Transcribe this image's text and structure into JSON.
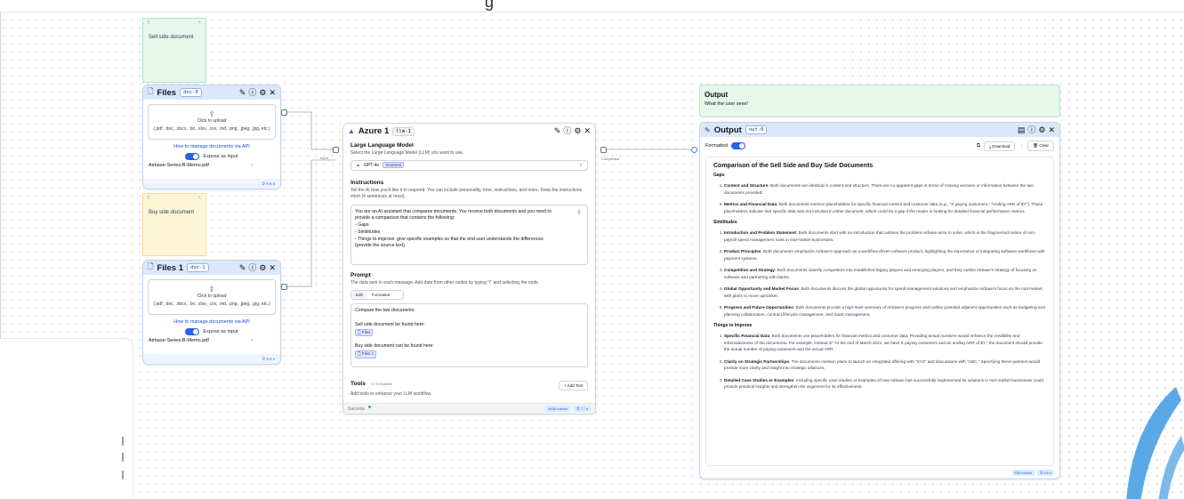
{
  "notes": {
    "sell": "Sell side document",
    "buy": "Buy side document",
    "output_title": "Output",
    "output_sub": "What the user sees!"
  },
  "files0": {
    "title": "Files",
    "tag": "doc-0",
    "upload_label": "Click to upload",
    "upload_types": "(.pdf, .doc, .docx, .txt, .xlsx, .csv, .md, .png, .jpeg, .jpg, etc.)",
    "api_link": "How to manage documents via API",
    "expose_label": "Expose as input",
    "file_name": "Airbase-Series-B-Memo.pdf",
    "footer": "⏱ 9.6 s"
  },
  "files1": {
    "title": "Files 1",
    "tag": "doc-1",
    "upload_label": "Click to upload",
    "upload_types": "(.pdf, .doc, .docx, .txt, .xlsx, .csv, .md, .png, .jpeg, .jpg, etc.)",
    "api_link": "How to manage documents via API",
    "expose_label": "Expose as input",
    "file_name": "Airbase-Series-B-Memo.pdf",
    "footer": "⏱ 3.2 s"
  },
  "llm": {
    "title": "Azure 1",
    "tag": "llm-1",
    "section_title": "Large Language Model",
    "section_sub": "Select the Large Language Model (LLM) you want to use.",
    "model": "GPT-4o",
    "model_badge": "Smartest",
    "instr_title": "Instructions",
    "instr_sub": "Tell the AI how you'd like it to respond. You can include personality, tone, instructions, and more. Keep the instructions short (4 sentences at most).",
    "instr_lines": [
      "You are an AI assistant that compares documents. You receive both documents and you need to",
      "provide a comparison that contains the following:",
      "- Gaps",
      "- Similitudes",
      "- Things to improve: give specific examples so that the end user understands the differences",
      "(provide the source text)"
    ],
    "prompt_title": "Prompt",
    "prompt_sub": "The data sent in each message. Add data from other nodes by typing \"/\" and selecting the node.",
    "tab_edit": "Edit",
    "tab_formatted": "Formatted",
    "prompt_l1": "Compare the two documents:",
    "prompt_l2": "Sell side document be found here:",
    "chip1": "Files",
    "prompt_l3": "Buy side document can be found here:",
    "chip2": "Files 1",
    "tools_title": "Tools",
    "tools_count": "0 / 5 Enabled",
    "tools_sub": "Add tools to enhance your LLM workflow.",
    "add_tool": "+ Add Tool",
    "status": "Success",
    "tokens": "4630 tokens",
    "time": "⏱ 7.7 s"
  },
  "edges": {
    "input": "Input",
    "completion": "Completion"
  },
  "output": {
    "title": "Output",
    "tag": "out-0",
    "formatted": "Formatted",
    "download": "Download",
    "clear": "Clear",
    "heading": "Comparison of the Sell Side and Buy Side Documents",
    "gaps_title": "Gaps",
    "gaps": [
      {
        "b": "Content and Structure",
        "t": ": Both documents are identical in content and structure. There are no apparent gaps in terms of missing sections or information between the two documents provided."
      },
      {
        "b": "Metrics and Financial Data",
        "t": ": Both documents mention placeholders for specific financial metrics and customer data (e.g., \"X paying customers,\" \"ending ARR of $Y\"). These placeholders indicate that specific data was not included in either document, which could be a gap if the reader is looking for detailed financial performance metrics."
      }
    ],
    "sim_title": "Similitudes",
    "sims": [
      {
        "b": "Introduction and Problem Statement",
        "t": ": Both documents start with an introduction that outlines the problem Airbase aims to solve, which is the fragmented nature of non-payroll spend management tools in mid-market businesses."
      },
      {
        "b": "Product Principles",
        "t": ": Both documents emphasize Airbase's approach as a workflow-driven software product, highlighting the importance of integrating software workflows with payment systems."
      },
      {
        "b": "Competition and Strategy",
        "t": ": Both documents classify competitors into established legacy players and emerging players, and they outline Airbase's strategy of focusing on software and partnering with banks."
      },
      {
        "b": "Global Opportunity and Market Focus",
        "t": ": Both documents discuss the global opportunity for spend management solutions and emphasize Airbase's focus on the mid-market, with plans to move upmarket."
      },
      {
        "b": "Progress and Future Opportunities",
        "t": ": Both documents provide a high-level summary of Airbase's progress and outline potential adjacent opportunities such as budgeting and planning collaboration, contract lifecycle management, and SaaS management."
      }
    ],
    "imp_title": "Things to Improve",
    "imps": [
      {
        "b": "Specific Financial Data",
        "t": ": Both documents use placeholders for financial metrics and customer data. Providing actual numbers would enhance the credibility and informativeness of the documents. For example, instead of \"At the end of March 2021, we have X paying customers and an ending ARR of $Y,\" the document should provide the actual number of paying customers and the actual ARR."
      },
      {
        "b": "Clarity on Strategic Partnerships",
        "t": ": The documents mention plans to launch an integrated offering with \"XYZ\" and discussions with \"ABC.\" Specifying these partners would provide more clarity and insight into strategic alliances."
      },
      {
        "b": "Detailed Case Studies or Examples",
        "t": ": Including specific case studies or examples of how Airbase has successfully implemented its solutions in mid-market businesses could provide practical insights and strengthen the argument for its effectiveness."
      }
    ],
    "tokens": "530 tokens",
    "time": "⏱ 0.6 s"
  },
  "colors": {
    "accent": "#2563eb",
    "header": "#dbe8fb",
    "note_green": "#e6f7ec",
    "note_yellow": "#fdf5d6",
    "success": "#22c55e",
    "feather": "#5aa9e6"
  }
}
